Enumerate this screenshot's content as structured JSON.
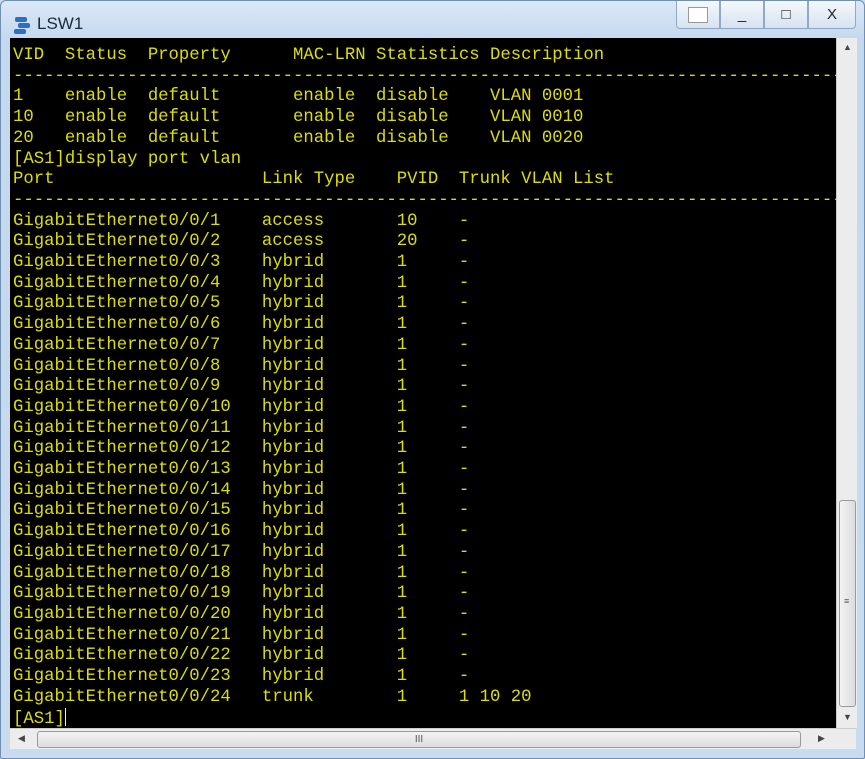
{
  "window": {
    "title": "LSW1",
    "buttons": {
      "restore_layout": "",
      "minimize": "_",
      "maximize": "□",
      "close": "X"
    }
  },
  "terminal": {
    "text_color": "#dede00",
    "background": "#000000",
    "lines": [
      "VID  Status  Property      MAC-LRN Statistics Description",
      "--------------------------------------------------------------------------------",
      "1    enable  default       enable  disable    VLAN 0001",
      "10   enable  default       enable  disable    VLAN 0010",
      "20   enable  default       enable  disable    VLAN 0020",
      "[AS1]display port vlan",
      "Port                    Link Type    PVID  Trunk VLAN List",
      "--------------------------------------------------------------------------------",
      "GigabitEthernet0/0/1    access       10    -",
      "GigabitEthernet0/0/2    access       20    -",
      "GigabitEthernet0/0/3    hybrid       1     -",
      "GigabitEthernet0/0/4    hybrid       1     -",
      "GigabitEthernet0/0/5    hybrid       1     -",
      "GigabitEthernet0/0/6    hybrid       1     -",
      "GigabitEthernet0/0/7    hybrid       1     -",
      "GigabitEthernet0/0/8    hybrid       1     -",
      "GigabitEthernet0/0/9    hybrid       1     -",
      "GigabitEthernet0/0/10   hybrid       1     -",
      "GigabitEthernet0/0/11   hybrid       1     -",
      "GigabitEthernet0/0/12   hybrid       1     -",
      "GigabitEthernet0/0/13   hybrid       1     -",
      "GigabitEthernet0/0/14   hybrid       1     -",
      "GigabitEthernet0/0/15   hybrid       1     -",
      "GigabitEthernet0/0/16   hybrid       1     -",
      "GigabitEthernet0/0/17   hybrid       1     -",
      "GigabitEthernet0/0/18   hybrid       1     -",
      "GigabitEthernet0/0/19   hybrid       1     -",
      "GigabitEthernet0/0/20   hybrid       1     -",
      "GigabitEthernet0/0/21   hybrid       1     -",
      "GigabitEthernet0/0/22   hybrid       1     -",
      "GigabitEthernet0/0/23   hybrid       1     -",
      "GigabitEthernet0/0/24   trunk        1     1 10 20"
    ],
    "prompt": "[AS1]"
  },
  "scrollbars": {
    "horizontal_grip": "III",
    "vertical_position_percent": 100
  }
}
